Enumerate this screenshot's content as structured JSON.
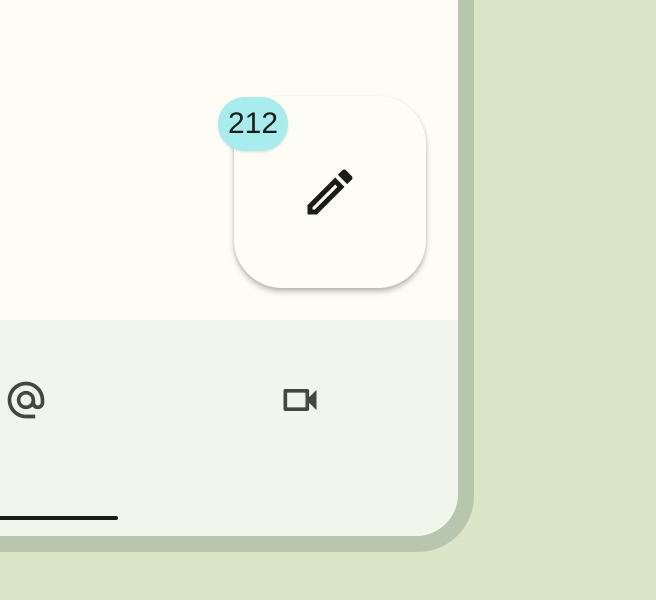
{
  "colors": {
    "background": "#dbe6c9",
    "frame": "#b8c6ae",
    "surface": "#fdfdf5",
    "bottom_bar": "#f2f5ec",
    "badge": "#a8eced",
    "icon": "#3f4a3c"
  },
  "fab": {
    "icon": "pencil-icon",
    "badge_count": "212"
  },
  "bottom_nav": {
    "items": [
      {
        "icon": "at-sign-icon"
      },
      {
        "icon": "video-camera-icon"
      }
    ]
  }
}
